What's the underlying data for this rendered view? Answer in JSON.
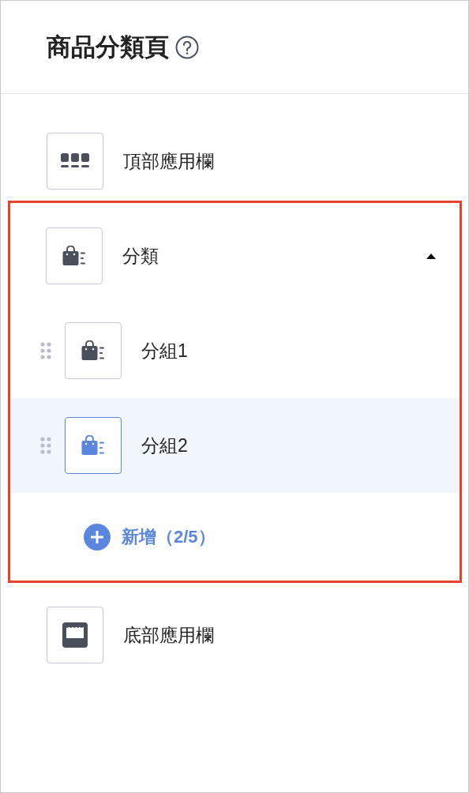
{
  "header": {
    "title": "商品分類頁"
  },
  "sections": [
    {
      "kind": "top_bar",
      "label": "頂部應用欄"
    },
    {
      "kind": "category",
      "label": "分類",
      "expanded": true,
      "highlighted": true,
      "children": [
        {
          "label": "分組1",
          "selected": false
        },
        {
          "label": "分組2",
          "selected": true
        }
      ],
      "add_button": "新增（2/5）"
    },
    {
      "kind": "bottom_bar",
      "label": "底部應用欄"
    }
  ]
}
